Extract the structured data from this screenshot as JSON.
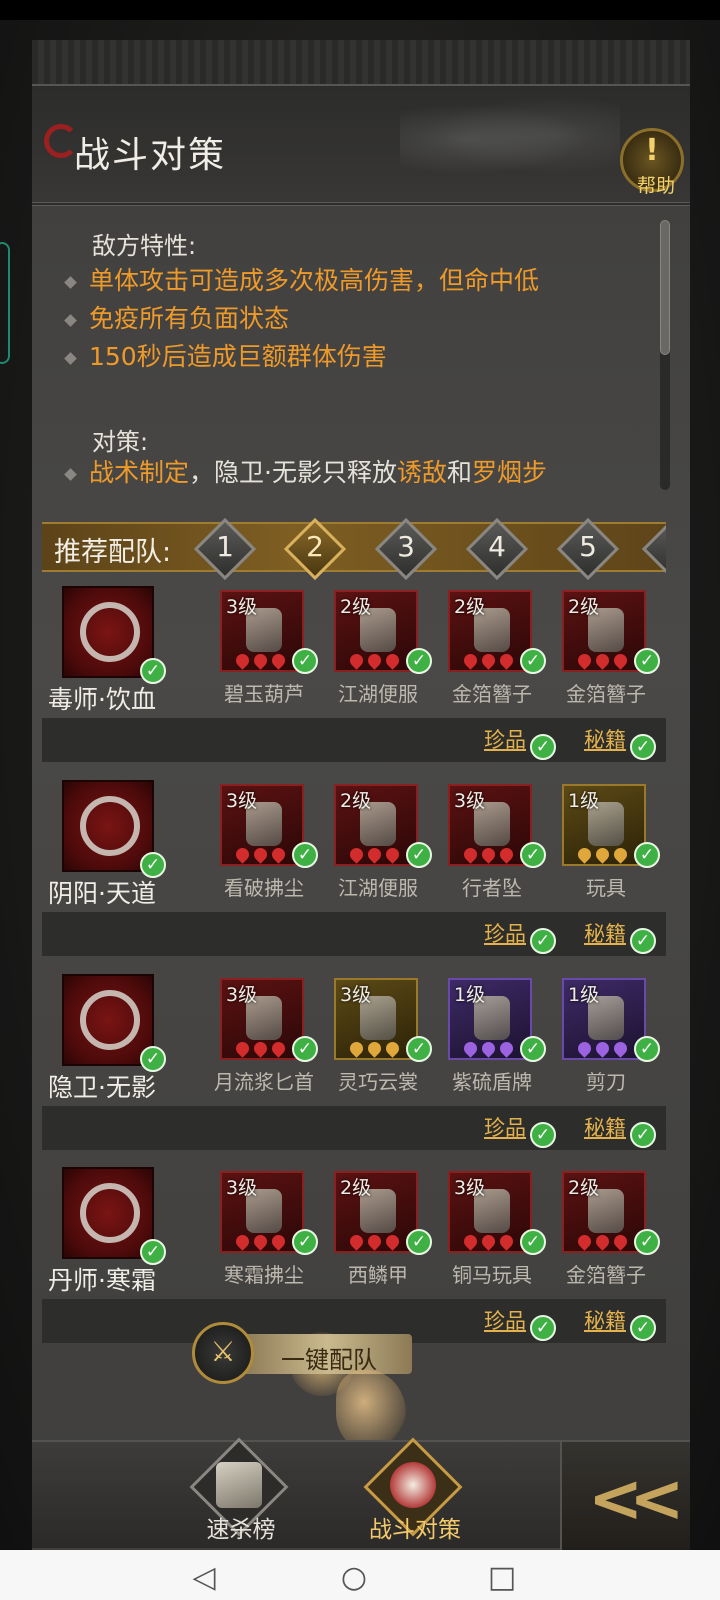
{
  "header": {
    "title": "战斗对策",
    "help_label": "帮助",
    "help_icon": "!"
  },
  "info": {
    "enemy_heading": "敌方特性:",
    "enemy_traits": [
      "单体攻击可造成多次极高伤害，但命中低",
      "免疫所有负面状态",
      "150秒后造成巨额群体伤害"
    ],
    "counter_heading": "对策:",
    "counter_parts": [
      "战术制定",
      "，隐卫·无影只释放",
      "诱敌",
      "和",
      "罗烟步"
    ]
  },
  "team": {
    "label": "推荐配队:",
    "tabs": [
      "1",
      "2",
      "3",
      "4",
      "5"
    ],
    "active_tab": "2"
  },
  "heroes": [
    {
      "name": "毒师·饮血",
      "emblem": "snake-emblem",
      "items": [
        {
          "level": "3级",
          "name": "碧玉葫芦",
          "rarity": "red"
        },
        {
          "level": "2级",
          "name": "江湖便服",
          "rarity": "red"
        },
        {
          "level": "2级",
          "name": "金箔簪子",
          "rarity": "red"
        },
        {
          "level": "2级",
          "name": "金箔簪子",
          "rarity": "red"
        }
      ]
    },
    {
      "name": "阴阳·天道",
      "emblem": "cloud-emblem",
      "items": [
        {
          "level": "3级",
          "name": "看破拂尘",
          "rarity": "red"
        },
        {
          "level": "2级",
          "name": "江湖便服",
          "rarity": "red"
        },
        {
          "level": "3级",
          "name": "行者坠",
          "rarity": "red"
        },
        {
          "level": "1级",
          "name": "玩具",
          "rarity": "gold"
        }
      ]
    },
    {
      "name": "隐卫·无影",
      "emblem": "eagle-emblem",
      "items": [
        {
          "level": "3级",
          "name": "月流浆匕首",
          "rarity": "red"
        },
        {
          "level": "3级",
          "name": "灵巧云裳",
          "rarity": "gold"
        },
        {
          "level": "1级",
          "name": "紫硫盾牌",
          "rarity": "purple"
        },
        {
          "level": "1级",
          "name": "剪刀",
          "rarity": "purple"
        }
      ]
    },
    {
      "name": "丹师·寒霜",
      "emblem": "snowflake-emblem",
      "items": [
        {
          "level": "3级",
          "name": "寒霜拂尘",
          "rarity": "red"
        },
        {
          "level": "2级",
          "name": "西鳞甲",
          "rarity": "red"
        },
        {
          "level": "3级",
          "name": "铜马玩具",
          "rarity": "red"
        },
        {
          "level": "2级",
          "name": "金箔簪子",
          "rarity": "red"
        }
      ]
    }
  ],
  "hero_footer": {
    "treasure_label": "珍品",
    "manual_label": "秘籍"
  },
  "quick_button": {
    "label": "一键配队"
  },
  "bottom_nav": {
    "items": [
      {
        "label": "速杀榜"
      },
      {
        "label": "战斗对策"
      }
    ],
    "back_glyph": "<<"
  },
  "colors": {
    "accent_orange": "#ee9a2a",
    "gold": "#e3b24c",
    "check_green": "#3fb044",
    "item_red": "#8a2020"
  }
}
